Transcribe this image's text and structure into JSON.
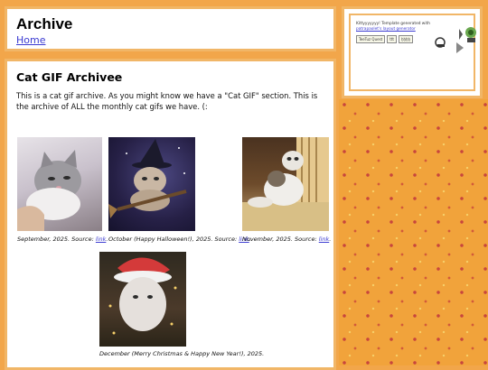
{
  "header": {
    "title": "Archive",
    "home_link": "Home"
  },
  "sidebar": {
    "credit_prefix": "Kittyyyyyyy! Template generated with",
    "credit_link": "patrapaolet's layout generator",
    "badges": [
      "TeeTuz Quest",
      "ṫṫṫ",
      "ḫḫḫḫ"
    ]
  },
  "main": {
    "title": "Cat GIF Archivee",
    "description": "This is a cat gif archive. As you might know we have a \"Cat GIF\" section. This is the archive of ALL the monthly cat gifs we have. (:",
    "gifs": [
      {
        "caption": "September, 2025. Source: ",
        "link": "link",
        "suffix": "."
      },
      {
        "caption": "October (Happy Halloween!), 2025. Source: ",
        "link": "link",
        "suffix": "."
      },
      {
        "caption": "November, 2025. Source: ",
        "link": "link",
        "suffix": "."
      },
      {
        "caption": "December (Merry Christmas & Happy New Year!), 2025.",
        "link": "",
        "suffix": ""
      }
    ]
  },
  "colors": {
    "background": "#f2a64a",
    "border": "#f1b667",
    "link": "#3a3ad1"
  }
}
